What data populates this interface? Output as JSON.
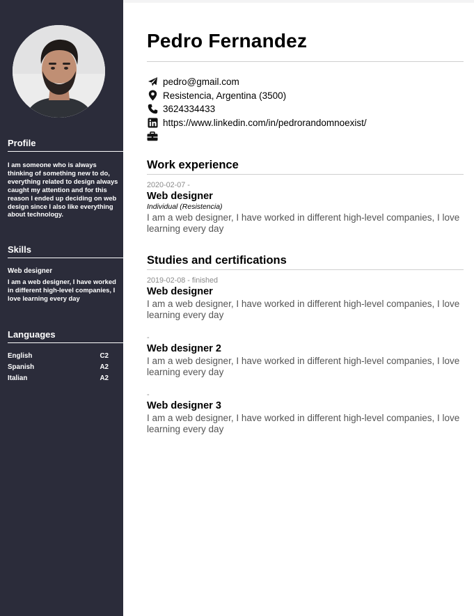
{
  "person": {
    "name": "Pedro Fernandez"
  },
  "contact": {
    "email": "pedro@gmail.com",
    "location": "Resistencia, Argentina (3500)",
    "phone": "3624334433",
    "linkedin": "https://www.linkedin.com/in/pedrorandomnoexist/",
    "portfolio": ""
  },
  "sidebar": {
    "profile": {
      "title": "Profile",
      "text": "I am someone who is always thinking of something new to do, everything related to design always caught my attention and for this reason I ended up deciding on web design since I also like everything about technology."
    },
    "skills": {
      "title": "Skills",
      "items": [
        {
          "name": "Web designer",
          "description": "I am a web designer, I have worked in different high-level companies, I love learning every day"
        }
      ]
    },
    "languages": {
      "title": "Languages",
      "items": [
        {
          "name": "English",
          "level": "C2"
        },
        {
          "name": "Spanish",
          "level": "A2"
        },
        {
          "name": "Italian",
          "level": "A2"
        }
      ]
    }
  },
  "work": {
    "title": "Work experience",
    "items": [
      {
        "date": "2020-02-07 -",
        "role": "Web designer",
        "company": "Individual (Resistencia)",
        "description": "I am a web designer, I have worked in different high-level companies, I love learning every day"
      }
    ]
  },
  "studies": {
    "title": "Studies and certifications",
    "items": [
      {
        "date": "2019-02-08 - finished",
        "role": "Web designer",
        "description": "I am a web designer, I have worked in different high-level companies, I love learning every day"
      },
      {
        "date": "-",
        "role": "Web designer 2",
        "description": "I am a web designer, I have worked in different high-level companies, I love learning every day"
      },
      {
        "date": "-",
        "role": "Web designer 3",
        "description": "I am a web designer, I have worked in different high-level companies, I love learning every day"
      }
    ]
  },
  "icons": {
    "email": "paper-plane-icon",
    "location": "map-pin-icon",
    "phone": "phone-icon",
    "linkedin": "linkedin-icon",
    "portfolio": "briefcase-icon"
  },
  "colors": {
    "sidebar_bg": "#2b2c3a",
    "sidebar_text": "#ffffff",
    "muted_text": "#555555",
    "date_text": "#8a8a8a"
  }
}
